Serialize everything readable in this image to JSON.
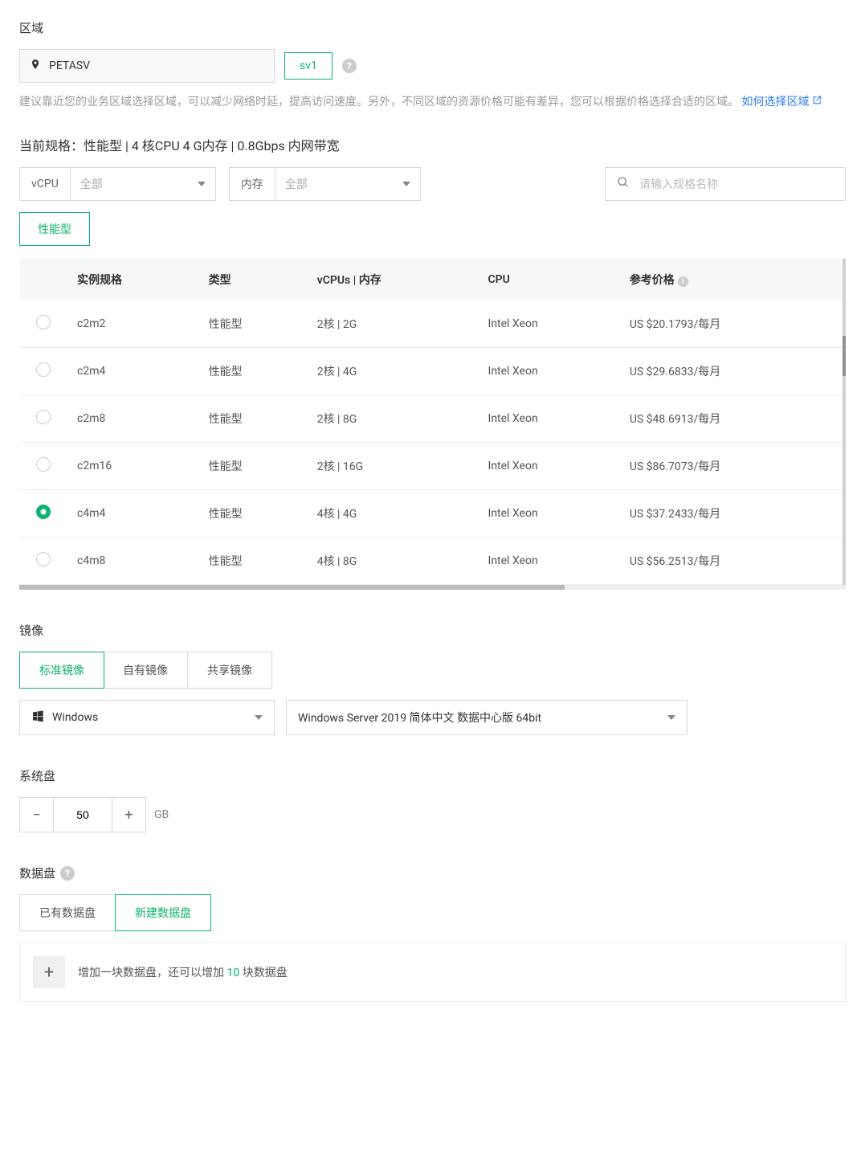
{
  "region": {
    "label": "区域",
    "value": "PETASV",
    "zone": "sv1",
    "hint_pre": "建议靠近您的业务区域选择区域，可以减少网络时延，提高访问速度。另外，不同区域的资源价格可能有差异，您可以根据价格选择合适的区域。",
    "link_text": "如何选择区域"
  },
  "spec": {
    "current_label": "当前规格：性能型 | 4 核CPU 4 G内存 | 0.8Gbps 内网带宽",
    "vcpu_label": "vCPU",
    "vcpu_all": "全部",
    "mem_label": "内存",
    "mem_all": "全部",
    "search_placeholder": "请输入规格名称",
    "type_tab": "性能型",
    "headers": {
      "spec": "实例规格",
      "type": "类型",
      "vcpu_mem": "vCPUs | 内存",
      "cpu": "CPU",
      "price": "参考价格"
    },
    "rows": [
      {
        "id": "c2m2",
        "type": "性能型",
        "vcpu": "2核 | 2G",
        "cpu": "Intel Xeon",
        "price": "US $20.1793/每月",
        "checked": false
      },
      {
        "id": "c2m4",
        "type": "性能型",
        "vcpu": "2核 | 4G",
        "cpu": "Intel Xeon",
        "price": "US $29.6833/每月",
        "checked": false
      },
      {
        "id": "c2m8",
        "type": "性能型",
        "vcpu": "2核 | 8G",
        "cpu": "Intel Xeon",
        "price": "US $48.6913/每月",
        "checked": false
      },
      {
        "id": "c2m16",
        "type": "性能型",
        "vcpu": "2核 | 16G",
        "cpu": "Intel Xeon",
        "price": "US $86.7073/每月",
        "checked": false
      },
      {
        "id": "c4m4",
        "type": "性能型",
        "vcpu": "4核 | 4G",
        "cpu": "Intel Xeon",
        "price": "US $37.2433/每月",
        "checked": true
      },
      {
        "id": "c4m8",
        "type": "性能型",
        "vcpu": "4核 | 8G",
        "cpu": "Intel Xeon",
        "price": "US $56.2513/每月",
        "checked": false
      }
    ]
  },
  "image": {
    "label": "镜像",
    "tabs": [
      "标准镜像",
      "自有镜像",
      "共享镜像"
    ],
    "os": "Windows",
    "version": "Windows Server 2019 简体中文 数据中心版 64bit"
  },
  "system_disk": {
    "label": "系统盘",
    "value": "50",
    "unit": "GB"
  },
  "data_disk": {
    "label": "数据盘",
    "tabs": [
      "已有数据盘",
      "新建数据盘"
    ],
    "add_pre": "增加一块数据盘，还可以增加 ",
    "add_count": "10",
    "add_post": " 块数据盘"
  }
}
